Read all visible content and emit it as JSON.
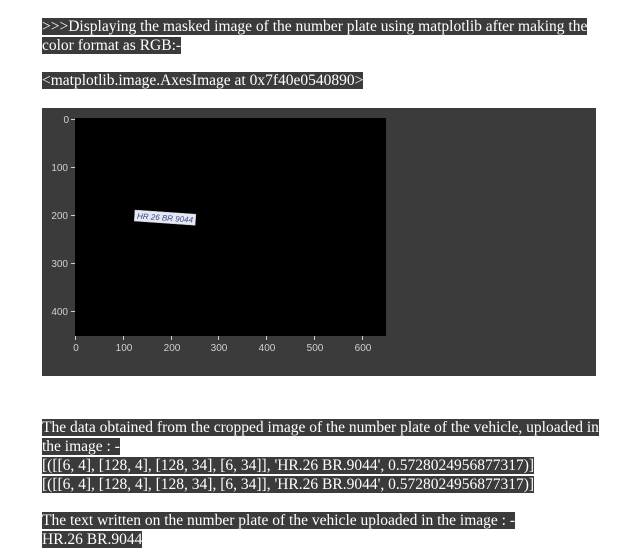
{
  "cell_text_1": ">>>Displaying the masked image of the number plate  using matplotlib after making the color format as RGB:-",
  "output_repr": "<matplotlib.image.AxesImage at 0x7f40e0540890>",
  "plot": {
    "x_ticks": [
      "0",
      "100",
      "200",
      "300",
      "400",
      "500",
      "600"
    ],
    "y_ticks": [
      "0",
      "100",
      "200",
      "300",
      "400"
    ],
    "plate_text": "HR 26 BR 9044",
    "colors": {
      "panel": "#3b3b3b",
      "image": "#000000",
      "plate": "#e6e9f2",
      "plate_text": "#3a4a8a"
    }
  },
  "cell_text_2": {
    "line1": " The data obtained from the cropped image of the number plate of the vehicle, uploaded in the image : - ",
    "line2": " [([[6, 4], [128, 4], [128, 34], [6, 34]], 'HR.26 BR.9044', 0.5728024956877317)]",
    "line3": "[([[6, 4], [128, 4], [128, 34], [6, 34]], 'HR.26 BR.9044', 0.5728024956877317)]"
  },
  "cell_text_3": {
    "line1": " The text written on the number plate of the vehicle uploaded in the image : - ",
    "line2": " HR.26 BR.9044"
  }
}
